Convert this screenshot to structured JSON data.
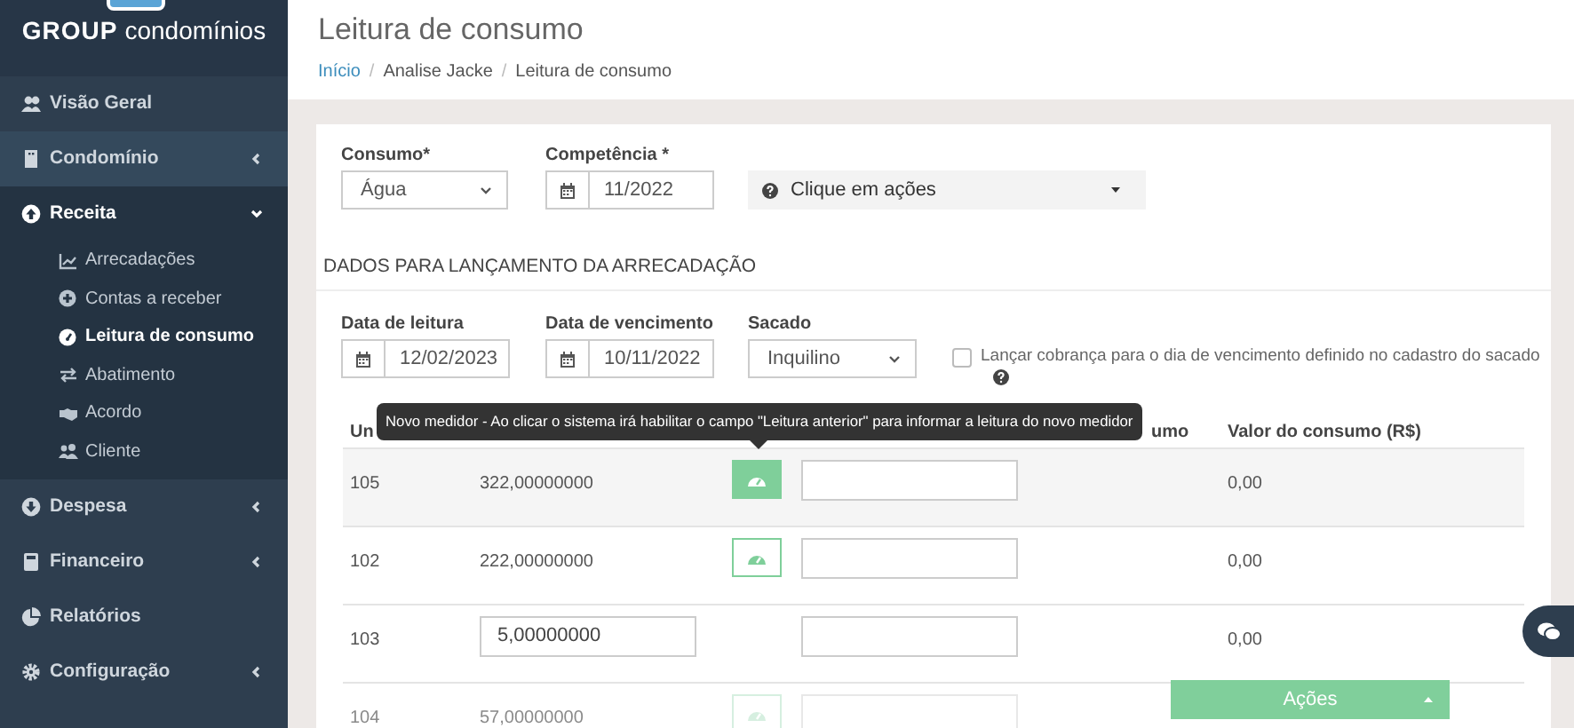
{
  "sidebar": {
    "brand_bold": "GROUP",
    "brand_light": "condomínios",
    "items": [
      {
        "label": "Visão Geral",
        "expandable": false,
        "expanded": false,
        "hovered": false
      },
      {
        "label": "Condomínio",
        "expandable": true,
        "expanded": false,
        "hovered": true
      },
      {
        "label": "Receita",
        "expandable": true,
        "expanded": true,
        "hovered": false,
        "children": [
          {
            "label": "Arrecadações",
            "selected": false
          },
          {
            "label": "Contas a receber",
            "selected": false
          },
          {
            "label": "Leitura de consumo",
            "selected": true
          },
          {
            "label": "Abatimento",
            "selected": false
          },
          {
            "label": "Acordo",
            "selected": false
          },
          {
            "label": "Cliente",
            "selected": false
          }
        ]
      },
      {
        "label": "Despesa",
        "expandable": true,
        "expanded": false,
        "hovered": false
      },
      {
        "label": "Financeiro",
        "expandable": true,
        "expanded": false,
        "hovered": false
      },
      {
        "label": "Relatórios",
        "expandable": false,
        "expanded": false,
        "hovered": false
      },
      {
        "label": "Configuração",
        "expandable": true,
        "expanded": false,
        "hovered": false
      }
    ]
  },
  "page": {
    "title": "Leitura de consumo",
    "breadcrumb_separator": "/",
    "breadcrumb": [
      {
        "label": "Início",
        "link": true
      },
      {
        "label": "Analise Jacke",
        "link": false
      },
      {
        "label": "Leitura de consumo",
        "link": false
      }
    ]
  },
  "filters": {
    "consumo": {
      "label": "Consumo*",
      "value": "Água"
    },
    "competencia": {
      "label": "Competência *",
      "value": "11/2022"
    },
    "actions_menu": {
      "label": "Clique em ações"
    }
  },
  "section_title": "DADOS PARA LANÇAMENTO DA ARRECADAÇÃO",
  "launch": {
    "reading_date": {
      "label": "Data de leitura",
      "value": "12/02/2023"
    },
    "due_date": {
      "label": "Data de vencimento",
      "value": "10/11/2022"
    },
    "payer": {
      "label": "Sacado",
      "value": "Inquilino"
    },
    "use_payer_due_day": {
      "label": "Lançar cobrança para o dia de vencimento definido no cadastro do sacado",
      "checked": false
    }
  },
  "table": {
    "column_1": "Un",
    "column_4": "umo",
    "column_5": "Valor do consumo (R$)",
    "rows": [
      {
        "unit": "105",
        "previous_reading": {
          "kind": "text",
          "value": "322,00000000"
        },
        "meter_button": true,
        "meter_button_filled": true,
        "dimmed": false,
        "value": "0,00"
      },
      {
        "unit": "102",
        "previous_reading": {
          "kind": "text",
          "value": "222,00000000"
        },
        "meter_button": true,
        "meter_button_filled": false,
        "dimmed": false,
        "value": "0,00"
      },
      {
        "unit": "103",
        "previous_reading": {
          "kind": "input",
          "value": "5,00000000"
        },
        "meter_button": false,
        "dimmed": false,
        "value": "0,00"
      },
      {
        "unit": "104",
        "previous_reading": {
          "kind": "text",
          "value": "57,00000000"
        },
        "meter_button": true,
        "meter_button_filled": false,
        "dimmed": true
      }
    ]
  },
  "tooltip": "Novo medidor - Ao clicar o sistema irá habilitar o campo \"Leitura anterior\" para informar a leitura do novo medidor",
  "actions_button": "Ações"
}
